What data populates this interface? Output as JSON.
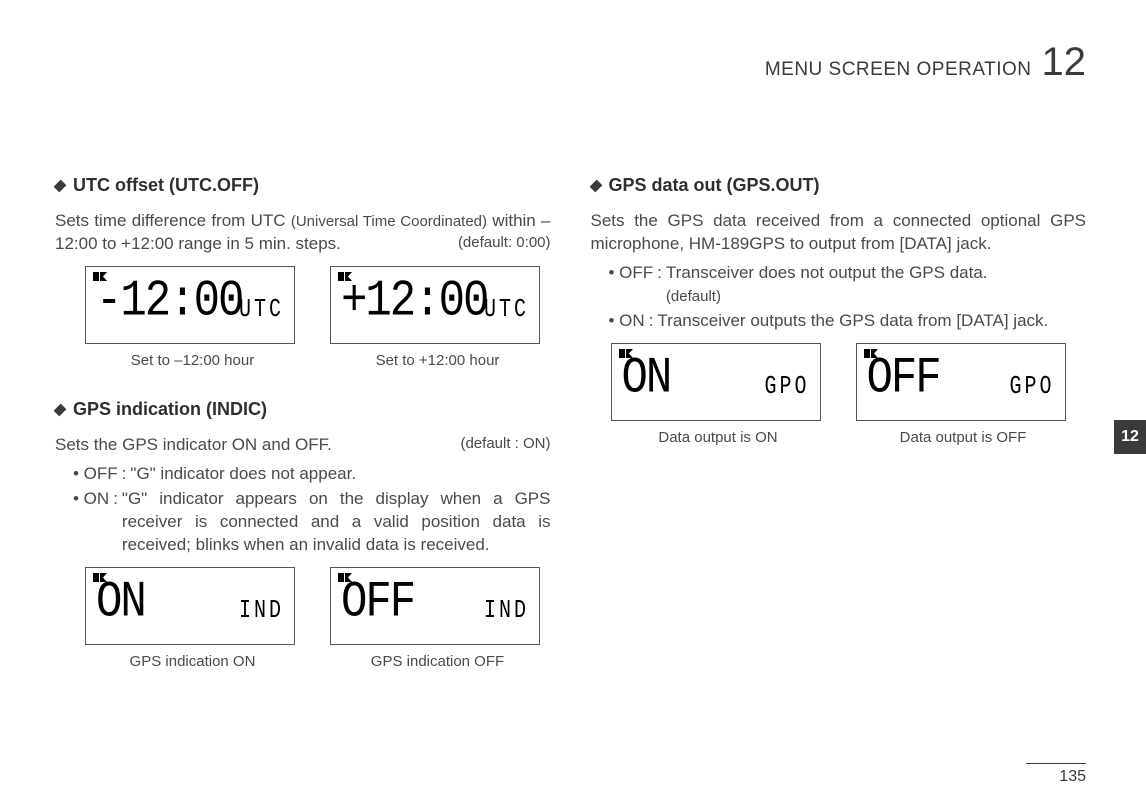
{
  "header": {
    "title": "MENU SCREEN OPERATION",
    "chapter": "12"
  },
  "sideTab": "12",
  "pageNumber": "135",
  "left": {
    "utc": {
      "heading": "UTC offset (UTC.OFF)",
      "desc_part1": "Sets time difference from UTC ",
      "desc_small": "(Universal Time Coordinated)",
      "desc_part2": " within –12:00 to +12:00 range in 5 min. steps.",
      "default": "(default: 0:00)",
      "lcd1": {
        "main": "-12:00",
        "sub": "UTC",
        "caption": "Set to –12:00 hour"
      },
      "lcd2": {
        "main": "+12:00",
        "sub": "UTC",
        "caption": "Set to +12:00 hour"
      }
    },
    "indic": {
      "heading": "GPS indication (INDIC)",
      "desc": "Sets the GPS indicator ON and OFF.",
      "default": "(default : ON)",
      "off": {
        "key": "• OFF",
        "desc": "\"G\" indicator does not appear."
      },
      "on": {
        "key": "• ON",
        "desc": "\"G\" indicator appears on the display when a GPS receiver is connected and a valid position data is received; blinks when an invalid data is received."
      },
      "lcd1": {
        "main": "ON",
        "sub": "IND",
        "caption": "GPS indication ON"
      },
      "lcd2": {
        "main": "OFF",
        "sub": "IND",
        "caption": "GPS indication OFF"
      }
    }
  },
  "right": {
    "gpo": {
      "heading": "GPS data out (GPS.OUT)",
      "desc": "Sets the GPS data received from a connected optional GPS microphone, HM-189GPS to output from [DATA] jack.",
      "off": {
        "key": "• OFF",
        "desc": "Transceiver does not output the GPS data.",
        "default": "(default)"
      },
      "on": {
        "key": "• ON",
        "desc": "Transceiver outputs the GPS data from [DATA] jack."
      },
      "lcd1": {
        "main": "ON",
        "sub": "GPO",
        "caption": "Data output is ON"
      },
      "lcd2": {
        "main": "OFF",
        "sub": "GPO",
        "caption": "Data output is OFF"
      }
    }
  }
}
